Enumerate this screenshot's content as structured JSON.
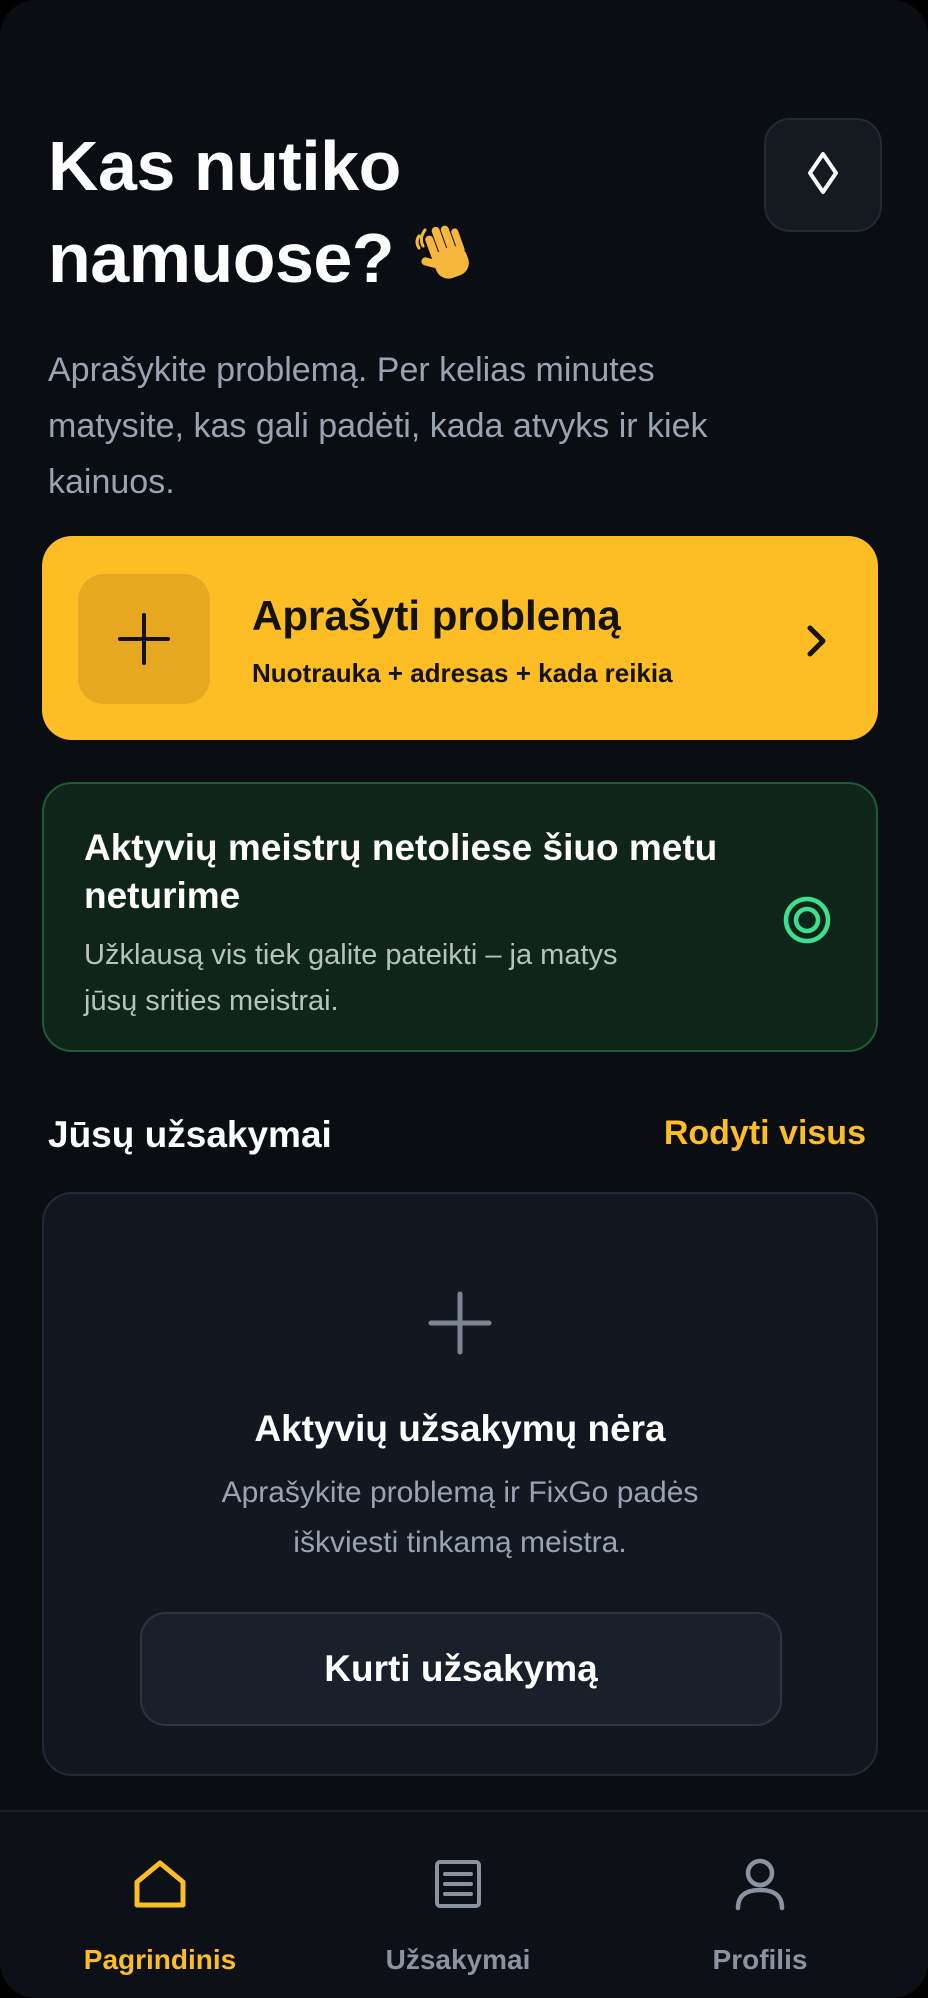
{
  "header": {
    "title_line1": "Kas nutiko",
    "title_line2": "namuose?",
    "title_emoji": "waving-hand",
    "subtitle": "Aprašykite problemą. Per kelias minutes matysite, kas gali padėti, kada atvyks ir kiek kainuos."
  },
  "theme_toggle": {
    "icon": "diamond-icon"
  },
  "cta": {
    "title": "Aprašyti problemą",
    "subtitle": "Nuotrauka + adresas + kada reikia",
    "icon": "plus-icon",
    "color": "#fcbd25"
  },
  "notice": {
    "title": "Aktyvių meistrų netoliese šiuo metu neturime",
    "subtitle": "Užklausą vis tiek galite pateikti – ja matys jūsų srities meistrai.",
    "icon": "target-icon",
    "accent": "#3ee08f"
  },
  "orders": {
    "section_title": "Jūsų užsakymai",
    "show_all": "Rodyti visus",
    "empty": {
      "title": "Aktyvių užsakymų nėra",
      "subtitle": "Aprašykite problemą ir FixGo padės iškviesti tinkamą meistra.",
      "button": "Kurti užsakymą"
    }
  },
  "nav": {
    "items": [
      {
        "label": "Pagrindinis",
        "icon": "home-icon",
        "active": true
      },
      {
        "label": "Užsakymai",
        "icon": "list-icon",
        "active": false
      },
      {
        "label": "Profilis",
        "icon": "user-icon",
        "active": false
      }
    ]
  }
}
